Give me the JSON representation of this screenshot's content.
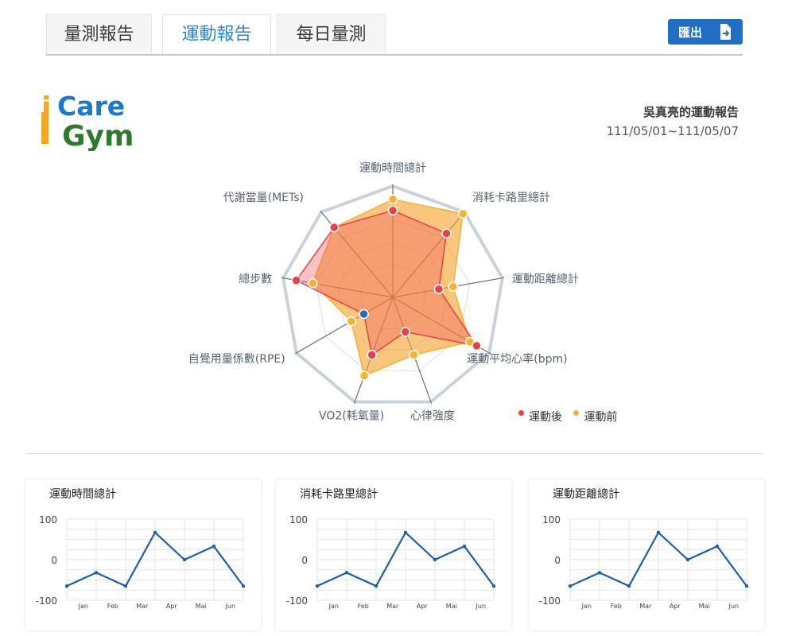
{
  "tabs": [
    {
      "label": "量測報告",
      "active": false
    },
    {
      "label": "運動報告",
      "active": true
    },
    {
      "label": "每日量測",
      "active": false
    }
  ],
  "export": {
    "label": "匯出",
    "icon": "file-export-icon"
  },
  "logo": {
    "line1_i": "i",
    "line1": "Care",
    "line2": "Gym",
    "colors": {
      "orange": "#f5a623",
      "blue": "#1e78c8",
      "green": "#2d7a2f"
    }
  },
  "report": {
    "title": "吳真亮的運動報告",
    "date_range": "111/05/01~111/05/07"
  },
  "legend": [
    {
      "label": "運動後",
      "color": "#e84046"
    },
    {
      "label": "運動前",
      "color": "#f5b230"
    }
  ],
  "chart_data": [
    {
      "type": "radar",
      "axes": [
        "運動時間總計",
        "消耗卡路里總計",
        "運動距離總計",
        "運動平均心率(bpm)",
        "心律強度",
        "VO2(耗氧量)",
        "自覺用量係數(RPE)",
        "總步數",
        "代謝當量(METs)"
      ],
      "max": 1,
      "series": [
        {
          "name": "運動後",
          "color": "#e84046",
          "fill": "rgba(240,80,90,0.35)",
          "values": [
            0.78,
            0.75,
            0.42,
            0.87,
            0.33,
            0.55,
            0.3,
            0.88,
            0.82
          ]
        },
        {
          "name": "運動前",
          "color": "#f5b230",
          "fill": "rgba(245,160,40,0.6)",
          "values": [
            0.88,
            0.98,
            0.55,
            0.8,
            0.55,
            0.75,
            0.43,
            0.73,
            0.82
          ]
        }
      ],
      "highlight_point": {
        "axis_index": 6,
        "color": "#1e6fc2"
      }
    },
    {
      "type": "line",
      "title": "運動時間總計",
      "categories": [
        "Jan",
        "Feb",
        "Mar",
        "Apr",
        "Mai",
        "Jun"
      ],
      "x": [
        0,
        1,
        2,
        3,
        4,
        5,
        6
      ],
      "values": [
        -65,
        -32,
        -65,
        67,
        0,
        33,
        -65
      ],
      "ylim": [
        -100,
        100
      ],
      "yticks": [
        100,
        0,
        -100
      ]
    },
    {
      "type": "line",
      "title": "消耗卡路里總計",
      "categories": [
        "Jan",
        "Feb",
        "Mar",
        "Apr",
        "Mai",
        "Jun"
      ],
      "x": [
        0,
        1,
        2,
        3,
        4,
        5,
        6
      ],
      "values": [
        -65,
        -32,
        -65,
        67,
        0,
        33,
        -65
      ],
      "ylim": [
        -100,
        100
      ],
      "yticks": [
        100,
        0,
        -100
      ]
    },
    {
      "type": "line",
      "title": "運動距離總計",
      "categories": [
        "Jan",
        "Feb",
        "Mar",
        "Apr",
        "Mai",
        "Jun"
      ],
      "x": [
        0,
        1,
        2,
        3,
        4,
        5,
        6
      ],
      "values": [
        -65,
        -32,
        -65,
        67,
        0,
        33,
        -65
      ],
      "ylim": [
        -100,
        100
      ],
      "yticks": [
        100,
        0,
        -100
      ]
    }
  ]
}
